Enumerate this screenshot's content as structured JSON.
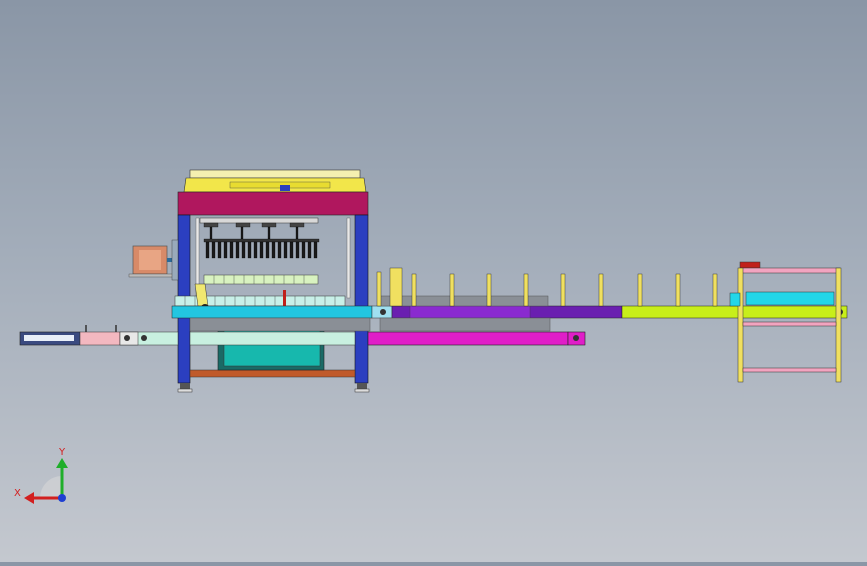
{
  "viewport": {
    "background_top": "#8a96a6",
    "background_bottom": "#c4c8cf"
  },
  "triad": {
    "x_label": "X",
    "y_label": "Y",
    "x_axis_color": "#d21f1f",
    "y_axis_color": "#1fae2a",
    "z_axis_color": "#1f3fd2"
  },
  "model_colors": {
    "frame_columns": "#2b3fc0",
    "top_beam": "#b0175e",
    "top_cap": "#f2e64a",
    "feed_conveyor_blue": "#22c6e0",
    "purple_segment": "#6a1fb0",
    "lime_segment": "#c8ee1a",
    "magenta_beam": "#e01ec8",
    "tank": "#17b8ad",
    "pink_frame": "#f2a4c0",
    "yellow_frame": "#f0e060"
  }
}
